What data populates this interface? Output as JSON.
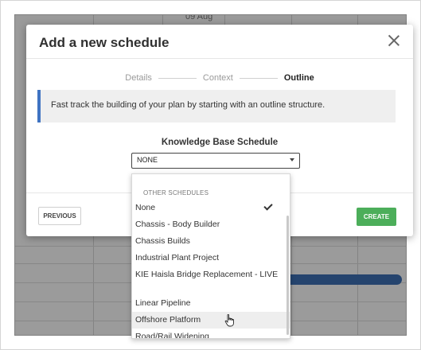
{
  "background": {
    "date_label": "09 Aug",
    "gantt_bar_color": "#3d6eb2"
  },
  "modal": {
    "title": "Add a new schedule",
    "close_icon": "close-icon",
    "steps": [
      {
        "label": "Details",
        "active": false
      },
      {
        "label": "Context",
        "active": false
      },
      {
        "label": "Outline",
        "active": true
      }
    ],
    "info_text": "Fast track the building of your plan by starting with an outline structure.",
    "kb_label": "Knowledge Base Schedule",
    "select_value": "NONE",
    "previous_label": "PREVIOUS",
    "create_label": "CREATE",
    "accent_color": "#3f73c2",
    "create_color": "#4cae5a"
  },
  "dropdown": {
    "group_label": "OTHER SCHEDULES",
    "items": [
      {
        "label": "None",
        "selected": true
      },
      {
        "label": "Chassis - Body Builder"
      },
      {
        "label": "Chassis Builds"
      },
      {
        "label": "Industrial Plant Project"
      },
      {
        "label": "KIE Haisla Bridge Replacement - LIVE"
      },
      {
        "label": "Linear Pipeline"
      },
      {
        "label": "Offshore Platform",
        "hovered": true
      },
      {
        "label": "Road/Rail Widening"
      }
    ]
  }
}
